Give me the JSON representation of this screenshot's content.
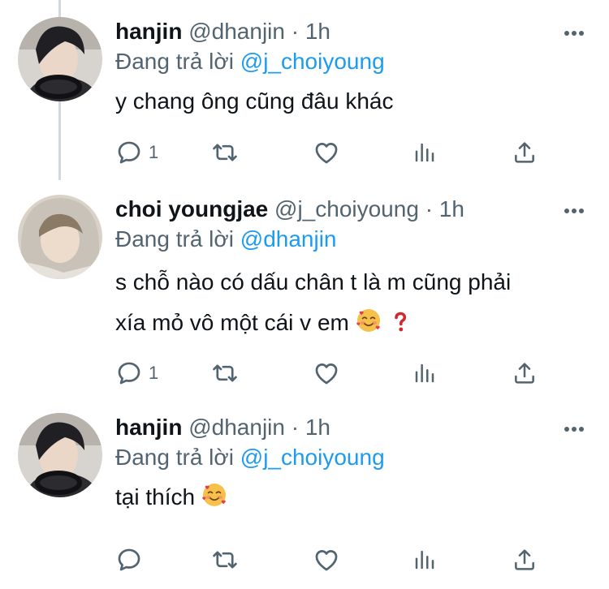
{
  "reply_prefix": "Đang trả lời",
  "tweets": [
    {
      "name": "hanjin",
      "handle": "@dhanjin",
      "separator": "·",
      "time": "1h",
      "reply_to": "@j_choiyoung",
      "text": "y chang ông cũng đâu khác",
      "reply_count": "1"
    },
    {
      "name": "choi youngjae",
      "handle": "@j_choiyoung",
      "separator": "·",
      "time": "1h",
      "reply_to": "@dhanjin",
      "text_line1": "s chỗ nào có dấu chân t là m cũng phải",
      "text_line2": "xía mỏ vô một cái v em",
      "reply_count": "1"
    },
    {
      "name": "hanjin",
      "handle": "@dhanjin",
      "separator": "·",
      "time": "1h",
      "reply_to": "@j_choiyoung",
      "text": "tại thích",
      "reply_count": ""
    }
  ],
  "colors": {
    "accent": "#1d9bf0",
    "muted": "#536471",
    "text": "#0f1419",
    "thread_line": "#cfd9de"
  },
  "icons": [
    "more-icon",
    "reply-icon",
    "retweet-icon",
    "like-icon",
    "analytics-icon",
    "share-icon",
    "smiling-face-with-hearts-emoji",
    "question-mark-emoji"
  ]
}
